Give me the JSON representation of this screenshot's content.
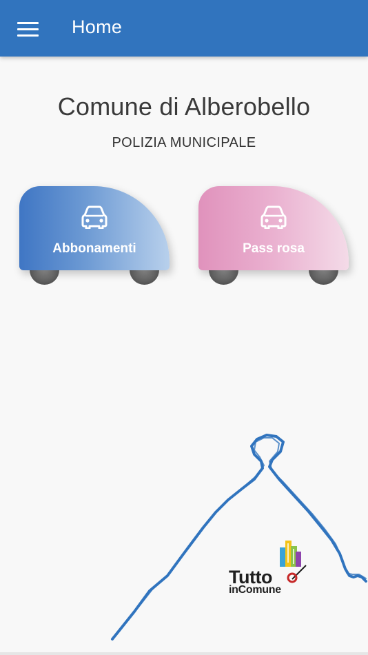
{
  "appbar": {
    "title": "Home",
    "menu_icon": "hamburger-menu-icon",
    "background_color": "#3174be"
  },
  "header": {
    "title": "Comune di Alberobello",
    "subtitle": "POLIZIA MUNICIPALE"
  },
  "cards": [
    {
      "label": "Abbonamenti",
      "icon": "car-icon",
      "gradient": [
        "#3f76c4",
        "#b8d0ec"
      ]
    },
    {
      "label": "Pass rosa",
      "icon": "car-icon",
      "gradient": [
        "#e092bc",
        "#f4dbe8"
      ]
    }
  ],
  "footer_logo": {
    "word1": "Tutto",
    "word2": "inComune",
    "decoration": "trullo-outline"
  }
}
